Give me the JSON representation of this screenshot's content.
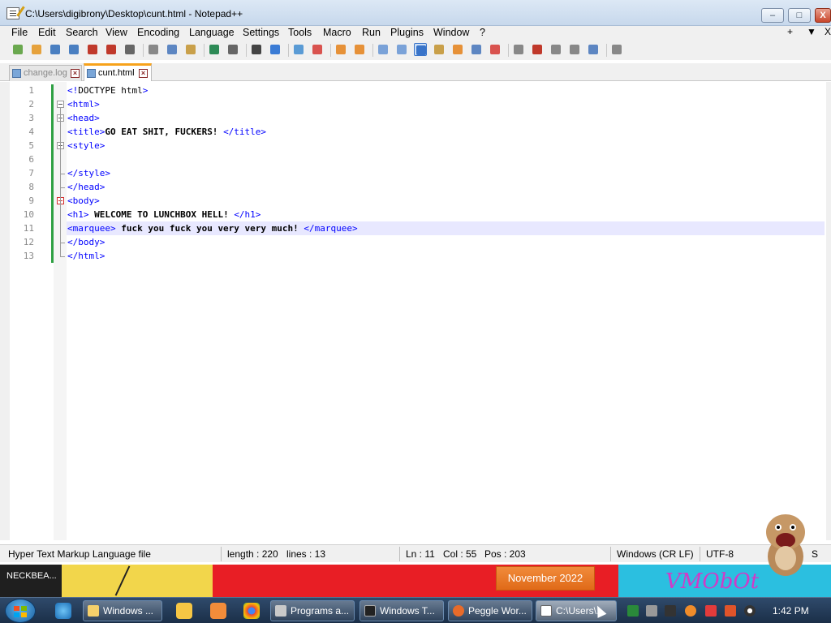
{
  "window": {
    "title": "C:\\Users\\digibrony\\Desktop\\cunt.html - Notepad++",
    "min_glyph": "–",
    "max_glyph": "□",
    "close_glyph": "X"
  },
  "menubar": {
    "items": [
      "File",
      "Edit",
      "Search",
      "View",
      "Encoding",
      "Language",
      "Settings",
      "Tools",
      "Macro",
      "Run",
      "Plugins",
      "Window",
      "?"
    ],
    "right": [
      "+",
      "▼",
      "X"
    ]
  },
  "toolbar": {
    "icons": [
      "new-file",
      "open-file",
      "save",
      "save-all",
      "close",
      "close-all",
      "print",
      "cut",
      "copy",
      "paste",
      "undo",
      "redo",
      "find",
      "replace",
      "zoom-in",
      "zoom-out",
      "sync-vertical",
      "sync-horizontal",
      "word-wrap",
      "show-all-chars",
      "indent-guide",
      "user-defined-lang",
      "doc-map",
      "function-list",
      "folder-workspace",
      "monitoring",
      "record-macro",
      "stop-record",
      "playback",
      "run-multiple",
      "save-macro"
    ],
    "accent": "#3974c9"
  },
  "tabs": [
    {
      "label": "change.log",
      "active": false
    },
    {
      "label": "cunt.html",
      "active": true
    }
  ],
  "editor": {
    "lines": [
      {
        "num": "1",
        "parts": [
          {
            "t": "<!",
            "c": "tag"
          },
          {
            "t": "DOCTYPE html",
            "c": "plain"
          },
          {
            "t": ">",
            "c": "tag"
          }
        ]
      },
      {
        "num": "2",
        "parts": [
          {
            "t": "<html>",
            "c": "tag"
          }
        ]
      },
      {
        "num": "3",
        "parts": [
          {
            "t": "<head>",
            "c": "tag"
          }
        ]
      },
      {
        "num": "4",
        "parts": [
          {
            "t": "<title>",
            "c": "tag"
          },
          {
            "t": "GO EAT SHIT, FUCKERS! ",
            "c": "txt"
          },
          {
            "t": "</title>",
            "c": "tag"
          }
        ]
      },
      {
        "num": "5",
        "parts": [
          {
            "t": "<style>",
            "c": "tag"
          }
        ]
      },
      {
        "num": "6",
        "parts": []
      },
      {
        "num": "7",
        "parts": [
          {
            "t": "</style>",
            "c": "tag"
          }
        ]
      },
      {
        "num": "8",
        "parts": [
          {
            "t": "</head>",
            "c": "tag"
          }
        ]
      },
      {
        "num": "9",
        "parts": [
          {
            "t": "<body>",
            "c": "tag"
          }
        ]
      },
      {
        "num": "10",
        "parts": [
          {
            "t": "<h1>",
            "c": "tag"
          },
          {
            "t": " WELCOME TO LUNCHBOX HELL! ",
            "c": "txt"
          },
          {
            "t": "</h1>",
            "c": "tag"
          }
        ]
      },
      {
        "num": "11",
        "parts": [
          {
            "t": "<marquee>",
            "c": "tag"
          },
          {
            "t": " fuck you fuck you very very much! ",
            "c": "txt"
          },
          {
            "t": "</marquee>",
            "c": "tag"
          }
        ]
      },
      {
        "num": "12",
        "parts": [
          {
            "t": "</body>",
            "c": "tag"
          }
        ]
      },
      {
        "num": "13",
        "parts": [
          {
            "t": "</html>",
            "c": "tag"
          }
        ]
      }
    ],
    "current_line": "11",
    "change_bar_color": "#2ea043"
  },
  "status": {
    "file_type": "Hyper Text Markup Language file",
    "length": "length : 220",
    "lines": "lines : 13",
    "ln": "Ln : 11",
    "col": "Col : 55",
    "pos": "Pos : 203",
    "eol": "Windows (CR LF)",
    "encoding": "UTF-8",
    "ins": "S"
  },
  "desktop": {
    "left_label": "NECKBEA...",
    "right_logo": "VMObOt",
    "date_popup": "November 2022"
  },
  "taskbar": {
    "tasks": [
      {
        "label": "Windows ...",
        "icon": "folder-icon"
      },
      {
        "label": "Programs a...",
        "icon": "programs-icon"
      },
      {
        "label": "Windows T...",
        "icon": "terminal-icon"
      },
      {
        "label": "Peggle Wor...",
        "icon": "peggle-icon"
      },
      {
        "label": "C:\\Users\\...",
        "icon": "notepad-icon"
      }
    ],
    "clock": "1:42 PM"
  }
}
